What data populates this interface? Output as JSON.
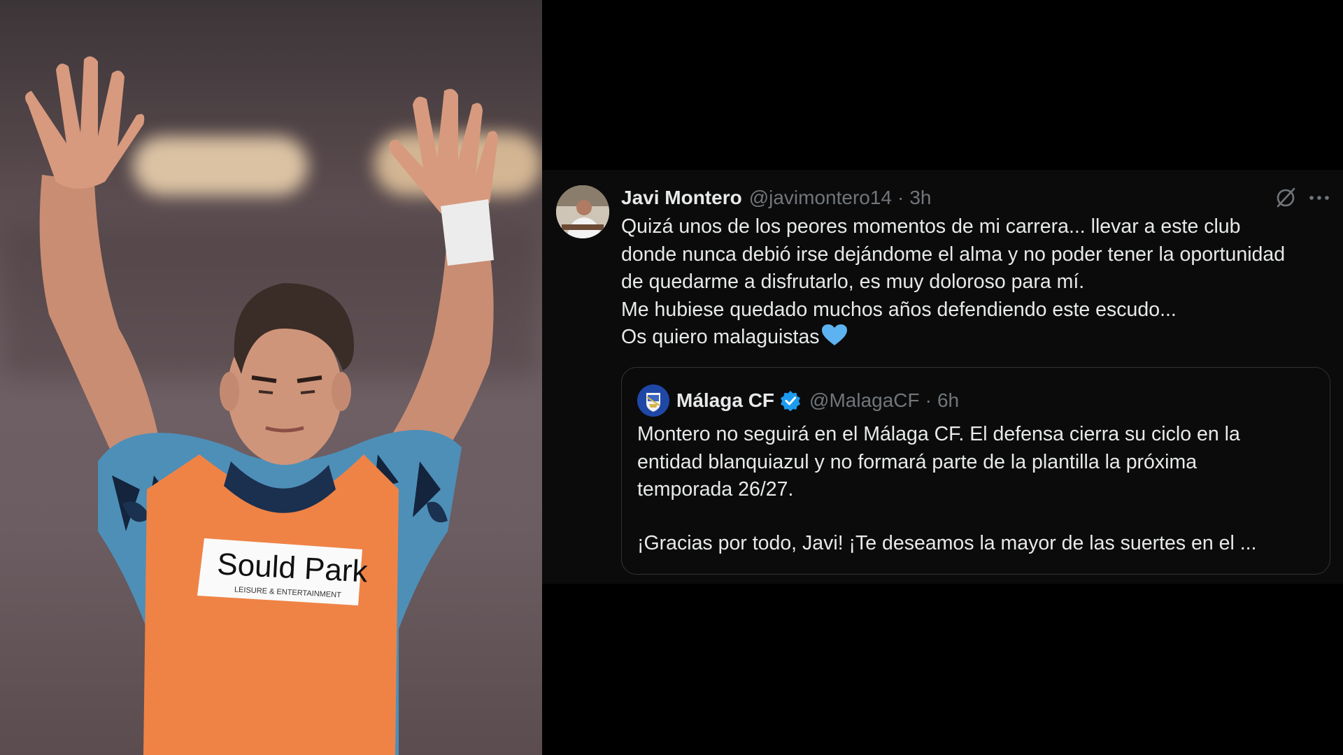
{
  "photo": {
    "bib_sponsor": "Sould Park",
    "bib_tagline": "LEISURE & ENTERTAINMENT"
  },
  "tweet": {
    "author_name": "Javi Montero",
    "author_handle": "@javimontero14",
    "separator": "·",
    "time": "3h",
    "lines": [
      "Quizá unos de los peores momentos de mi carrera... llevar a este club",
      "donde nunca debió irse dejándome el alma y no poder tener la oportunidad",
      "de quedarme a disfrutarlo, es muy doloroso para mí.",
      "Me hubiese quedado muchos años defendiendo este escudo...",
      "Os quiero malaguistas"
    ],
    "emoji": "blue-heart",
    "actions": [
      "grok-icon",
      "more-icon"
    ],
    "quoted": {
      "name": "Málaga CF",
      "verified": true,
      "handle": "@MalagaCF",
      "separator": "·",
      "time": "6h",
      "paragraph1": [
        "Montero no seguirá en el Málaga CF. El defensa cierra su ciclo en la",
        "entidad blanquiazul y no formará parte de la plantilla la próxima",
        "temporada 26/27."
      ],
      "paragraph2": "¡Gracias por todo, Javi! ¡Te deseamos la mayor de las suertes en el ..."
    }
  },
  "colors": {
    "background": "#000000",
    "tweet_bg": "#0b0b0b",
    "text": "#e7e9ea",
    "secondary": "#71767b",
    "border": "#2f3336",
    "verified": "#1d9bf0",
    "heart": "#5db3f0"
  }
}
